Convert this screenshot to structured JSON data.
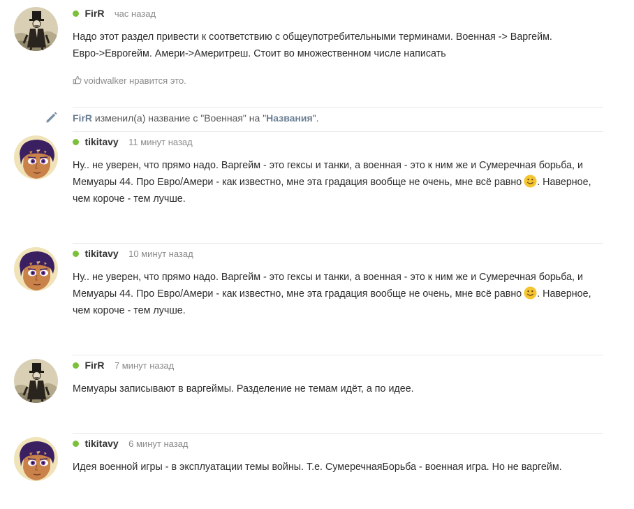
{
  "comments": [
    {
      "author": "FirR",
      "time": "час назад",
      "avatar": "gentleman",
      "lines": [
        "Надо этот раздел привести к соответствию с общеупотребительными терминами. Военная -> Варгейм.",
        "Евро->Еврогейм. Амери->Америтреш. Стоит во множественном числе написать"
      ],
      "likes": "voidwalker нравится это."
    },
    {
      "author": "tikitavy",
      "time": "11 минут назад",
      "avatar": "anime",
      "line1": "Ну.. не уверен, что прямо надо. Варгейм - это гексы и танки, а военная - это к ним же и Сумеречная борьба, и",
      "line2a": "Мемуары 44. Про Евро/Амери - как известно, мне эта градация вообще не очень, мне всё равно",
      "line2b": ". Наверное,",
      "line3": "чем короче - тем лучше."
    },
    {
      "author": "tikitavy",
      "time": "10 минут назад",
      "avatar": "anime",
      "line1": "Ну.. не уверен, что прямо надо. Варгейм - это гексы и танки, а военная - это к ним же и Сумеречная борьба, и",
      "line2a": "Мемуары 44. Про Евро/Амери - как известно, мне эта градация вообще не очень, мне всё равно",
      "line2b": ". Наверное,",
      "line3": "чем короче - тем лучше."
    },
    {
      "author": "FirR",
      "time": "7 минут назад",
      "avatar": "gentleman",
      "line1": "Мемуары записывают в варгеймы. Разделение не темам идёт, а по идее."
    },
    {
      "author": "tikitavy",
      "time": "6 минут назад",
      "avatar": "anime",
      "line1": "Идея военной игры - в эксплуатации темы войны. Т.е. СумеречнаяБорьба - военная игра. Но не варгейм."
    }
  ],
  "rename_event": {
    "author": "FirR",
    "action": " изменил(а) название с \"Военная\" на \"",
    "new_name": "Названия",
    "tail": "\"."
  },
  "icons": {
    "online": "online-dot-icon",
    "like": "thumbs-up-icon",
    "edit": "pencil-icon",
    "smile": "smile-emoji-icon"
  },
  "colors": {
    "online": "#7cc03a",
    "author_link": "#6b7f93",
    "meta": "#8a8a8a",
    "emoji": "#f5c531"
  }
}
